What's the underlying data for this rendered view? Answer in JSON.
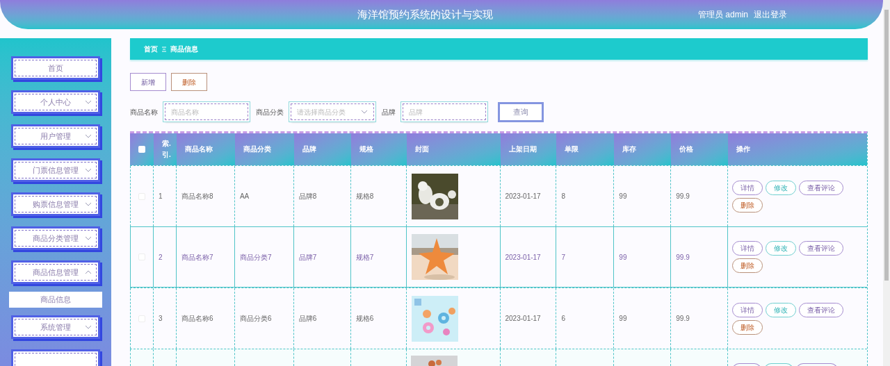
{
  "header": {
    "title": "海洋馆预约系统的设计与实现",
    "user": "管理员 admin",
    "logout": "退出登录"
  },
  "sidebar": {
    "items": [
      {
        "label": "首页",
        "kind": "link"
      },
      {
        "label": "个人中心",
        "kind": "group",
        "expanded": false
      },
      {
        "label": "用户管理",
        "kind": "group",
        "expanded": false
      },
      {
        "label": "门票信息管理",
        "kind": "group",
        "expanded": false
      },
      {
        "label": "购票信息管理",
        "kind": "group",
        "expanded": false
      },
      {
        "label": "商品分类管理",
        "kind": "group",
        "expanded": false
      },
      {
        "label": "商品信息管理",
        "kind": "group",
        "expanded": true,
        "children": [
          {
            "label": "商品信息",
            "selected": true
          }
        ]
      },
      {
        "label": "系统管理",
        "kind": "group",
        "expanded": false
      },
      {
        "kind": "cut"
      }
    ]
  },
  "breadcrumb": [
    "首页",
    "商品信息"
  ],
  "toolbar": [
    {
      "label": "新增",
      "kind": "add"
    },
    {
      "label": "删除",
      "kind": "delete"
    }
  ],
  "search": {
    "fields": [
      {
        "label": "商品名称",
        "placeholder": "商品名称",
        "kind": "input"
      },
      {
        "label": "商品分类",
        "placeholder": "请选择商品分类",
        "kind": "select"
      },
      {
        "label": "品牌",
        "placeholder": "品牌",
        "kind": "input"
      }
    ],
    "button": "查询"
  },
  "table": {
    "select_all": {
      "checked": false
    },
    "columns": [
      "索.引.",
      "商品名称",
      "商品分类",
      "品牌",
      "规格",
      "封面",
      "上架日期",
      "单限",
      "库存",
      "价格",
      "操作"
    ],
    "rows": [
      {
        "kind": "full",
        "checked": false,
        "hovered": false,
        "cells": [
          "1",
          "商品名称8",
          "AA",
          "品牌8",
          "规格8"
        ],
        "rest": [
          "2023-01-17",
          "8",
          "99",
          "99.9"
        ],
        "actions": [
          {
            "label": "详情",
            "kind": "detail"
          },
          {
            "label": "修改",
            "kind": "edit"
          },
          {
            "label": "查看评论",
            "kind": "comments"
          },
          {
            "label": "删除",
            "kind": "delete"
          }
        ]
      },
      {
        "kind": "full",
        "checked": false,
        "hovered": true,
        "cells": [
          "2",
          "商品名称7",
          "商品分类7",
          "品牌7",
          "规格7"
        ],
        "rest": [
          "2023-01-17",
          "7",
          "99",
          "99.9"
        ],
        "actions": [
          {
            "label": "详情",
            "kind": "detail"
          },
          {
            "label": "修改",
            "kind": "edit"
          },
          {
            "label": "查看评论",
            "kind": "comments"
          },
          {
            "label": "删除",
            "kind": "delete"
          }
        ]
      },
      {
        "kind": "full",
        "checked": false,
        "hovered": false,
        "cells": [
          "3",
          "商品名称6",
          "商品分类6",
          "品牌6",
          "规格6"
        ],
        "rest": [
          "2023-01-17",
          "6",
          "99",
          "99.9"
        ],
        "actions": [
          {
            "label": "详情",
            "kind": "detail"
          },
          {
            "label": "修改",
            "kind": "edit"
          },
          {
            "label": "查看评论",
            "kind": "comments"
          },
          {
            "label": "删除",
            "kind": "delete"
          }
        ]
      },
      {
        "kind": "cut",
        "actions": [
          {
            "kind": "detail"
          },
          {
            "kind": "edit"
          },
          {
            "kind": "comments"
          }
        ]
      }
    ]
  }
}
